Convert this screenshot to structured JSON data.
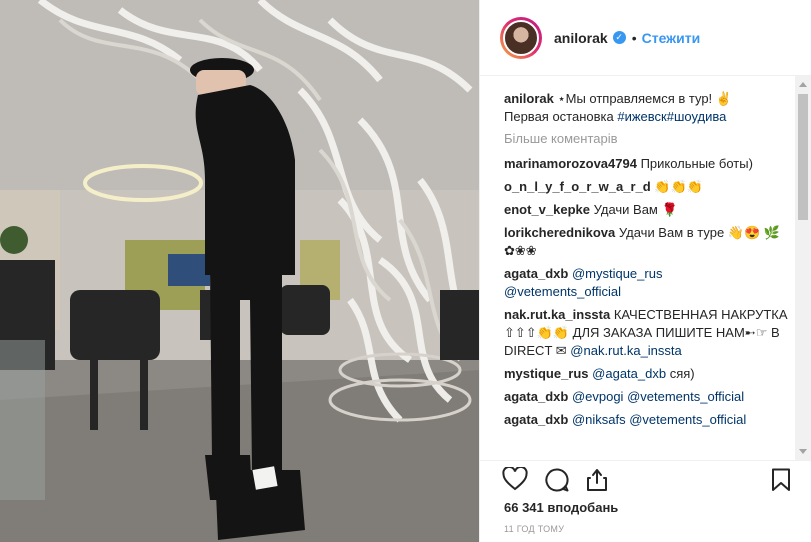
{
  "post": {
    "username": "anilorak",
    "follow_label": "Стежити",
    "caption_user": "anilorak",
    "caption_line1": " ⋆Мы отправляемся в тур! ✌",
    "caption_line2": "Первая остановка ",
    "hashtag1": "#ижевск",
    "hashtag2": "#шоудива",
    "more_comments": "Більше коментарів",
    "likes": "66 341 вподобань",
    "time": "11 год тому"
  },
  "comments": [
    {
      "user": "marinamorozova4794",
      "text": " Прикольные боты)"
    },
    {
      "user": "o_n_l_y_f_o_r_w_a_r_d",
      "text": " 👏👏👏"
    },
    {
      "user": "enot_v_kepke",
      "text": " Удачи Вам 🌹"
    },
    {
      "user": "lorikcherednikova",
      "text": " Удачи Вам в туре 👋😍 🌿✿❀❀"
    },
    {
      "user": "agata_dxb",
      "mention1": "@mystique_rus",
      "mention2": "@vetements_official"
    },
    {
      "user": "nak.rut.ka_inssta",
      "text": " КАЧЕСТВЕННАЯ НАКРУТКА ⇧⇧⇧👏👏 ДЛЯ ЗАКАЗА ПИШИТЕ НАМ➸☞ В DIRECT ✉ ",
      "mention1": "@nak.rut.ka_inssta"
    },
    {
      "user": "mystique_rus",
      "mention1": "@agata_dxb",
      "text": " сяя)"
    },
    {
      "user": "agata_dxb",
      "mention1": "@evpogi",
      "mention2": "@vetements_official"
    },
    {
      "user": "agata_dxb",
      "mention1": "@niksafs",
      "mention2": "@vetements_official"
    }
  ],
  "icons": {
    "like": "heart-icon",
    "comment": "comment-icon",
    "share": "share-icon",
    "save": "bookmark-icon",
    "verified": "verified-badge-icon"
  },
  "colors": {
    "link": "#003569",
    "follow": "#3897f0",
    "muted": "#999999"
  }
}
